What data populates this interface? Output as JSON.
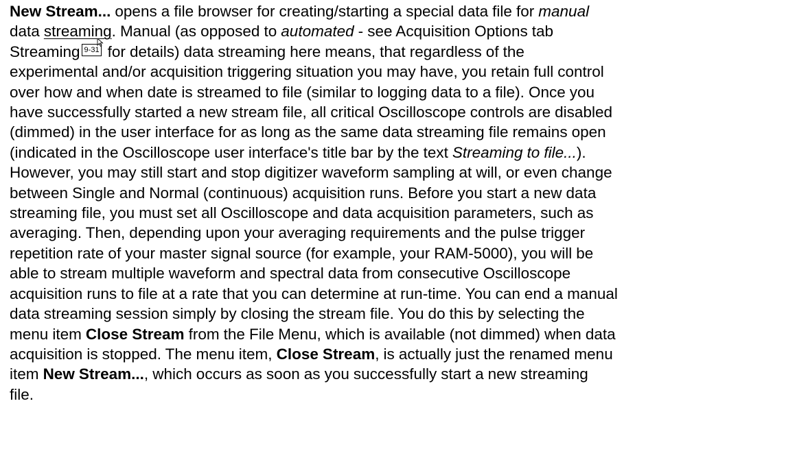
{
  "para": {
    "l1": {
      "b1": "New Stream...",
      "t1": " opens a file browser for creating/starting a special data file for ",
      "i1": "manual"
    },
    "l2": {
      "t1": "data ",
      "link": "streaming",
      "t2": ". Manual (as opposed to ",
      "i1": "automated",
      "t3": " - see Acquisition Options tab"
    },
    "l3": {
      "t1": "Streaming",
      "xref": "9-31",
      "t2": " for details) data streaming here means, that regardless of the"
    },
    "l4": "experimental and/or acquisition triggering situation you may have, you retain full control",
    "l5": "over how and when date is streamed to file (similar to logging data to a file). Once you",
    "l6": "have successfully started a new stream file, all critical Oscilloscope controls are disabled",
    "l7": "(dimmed) in the user interface for as long as the same data streaming file remains open",
    "l8": {
      "t1": "(indicated in the Oscilloscope user interface's title bar by the text ",
      "i1": "Streaming to file...",
      "t2": ")."
    },
    "l9": "However, you may still start and stop digitizer waveform sampling at will, or even change",
    "l10": "between Single and Normal (continuous) acquisition runs. Before you start a new data",
    "l11": "streaming file, you must set all Oscilloscope and data acquisition parameters, such as",
    "l12": "averaging. Then, depending upon your averaging requirements and the pulse trigger",
    "l13": "repetition rate of your master signal source (for example, your RAM-5000), you will be",
    "l14": "able to stream multiple waveform and spectral data from consecutive Oscilloscope",
    "l15": "acquisition runs to file at a rate that you can determine at run-time. You can end a manual",
    "l16": "data streaming session simply by closing the stream file. You do this by selecting the",
    "l17": {
      "t1": "menu item ",
      "b1": "Close Stream",
      "t2": " from the File Menu, which is available (not dimmed) when data"
    },
    "l18": {
      "t1": "acquisition is stopped. The menu item, ",
      "b1": "Close Stream",
      "t2": ", is actually just the renamed menu"
    },
    "l19": {
      "t1": "item ",
      "b1": "New Stream...",
      "t2": ", which occurs as soon as you successfully start a new streaming"
    },
    "l20": "file."
  },
  "colors": {
    "text": "#000000",
    "background": "#ffffff"
  },
  "icons": {
    "xref_arrow": "cross-reference-arrow-icon"
  }
}
